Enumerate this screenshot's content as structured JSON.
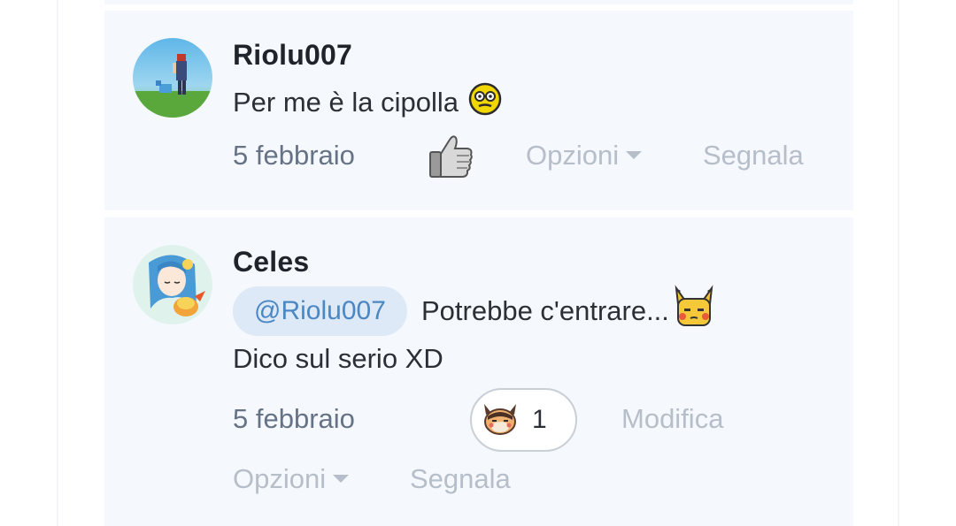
{
  "posts": [
    {
      "username": "Riolu007",
      "message": "Per me è la cipolla",
      "date": "5 febbraio",
      "options_label": "Opzioni",
      "report_label": "Segnala",
      "icons": {
        "emoji": "confused-face-emoji-icon",
        "like": "thumbs-up-icon"
      }
    },
    {
      "username": "Celes",
      "mention": "@Riolu007",
      "message_line1": "Potrebbe c'entrare...",
      "message_line2": "Dico sul serio XD",
      "date": "5 febbraio",
      "reaction_count": "1",
      "edit_label": "Modifica",
      "options_label": "Opzioni",
      "report_label": "Segnala",
      "icons": {
        "emoji": "pikachu-emoji-icon",
        "reaction": "pokemon-face-reaction-icon"
      }
    }
  ],
  "colors": {
    "card_background": "#f5f8fc",
    "date_text": "#667386",
    "muted_action": "#b6bec9",
    "mention_bg": "#dde9f6",
    "mention_text": "#4a87c3"
  }
}
